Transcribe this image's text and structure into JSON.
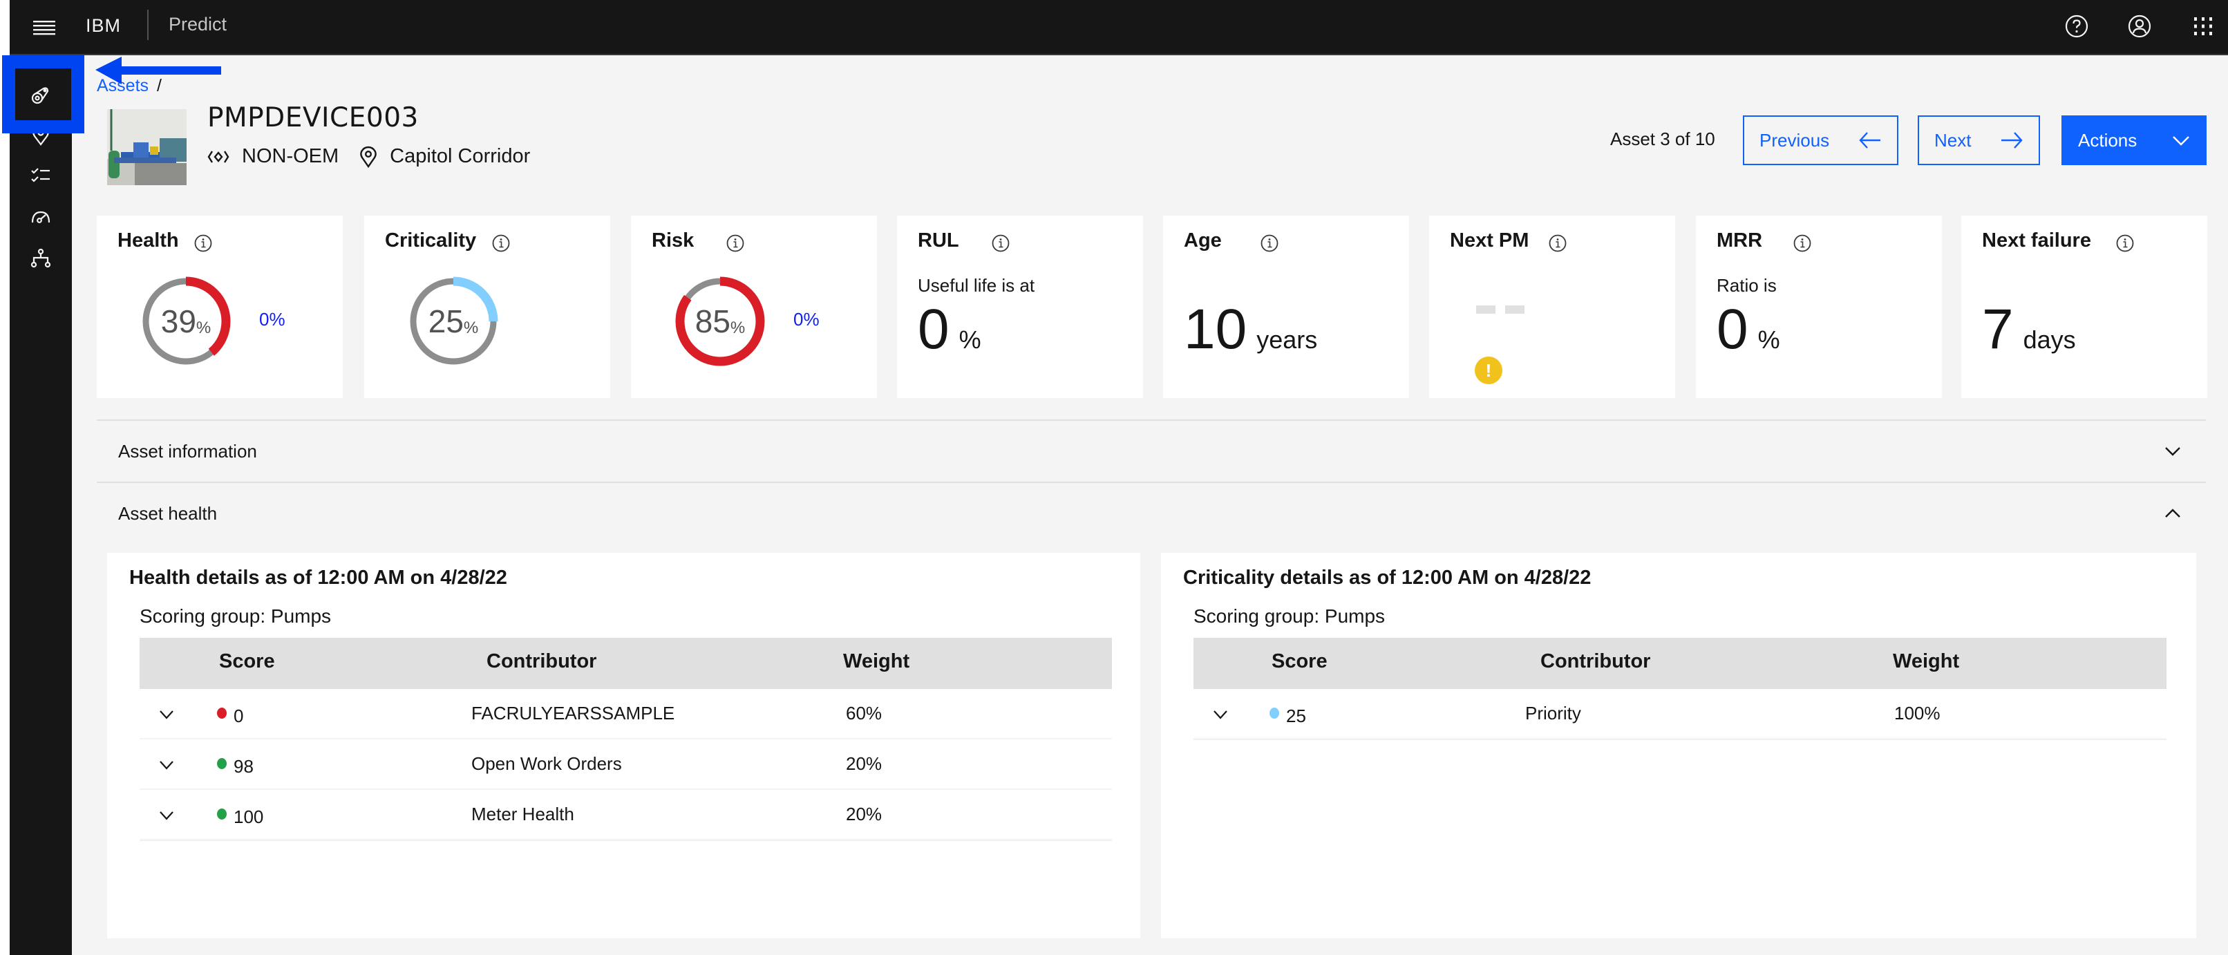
{
  "header": {
    "brand": "IBM",
    "product": "Predict",
    "icons": [
      "help-icon",
      "user-avatar-icon",
      "app-switcher-icon"
    ]
  },
  "sidebar": {
    "items": [
      {
        "icon": "asset-icon",
        "label": "Assets",
        "active": true
      },
      {
        "icon": "location-icon",
        "label": "Locations"
      },
      {
        "icon": "checklist-icon",
        "label": "Work"
      },
      {
        "icon": "dashboard-gauge-icon",
        "label": "Dashboard"
      },
      {
        "icon": "hierarchy-icon",
        "label": "Hierarchy"
      }
    ]
  },
  "breadcrumb": {
    "link": "Assets",
    "separator": "/"
  },
  "asset": {
    "id": "PMPDEVICE003",
    "type": "NON-OEM",
    "location": "Capitol Corridor"
  },
  "pager": {
    "text": "Asset 3 of 10",
    "previous_label": "Previous",
    "next_label": "Next",
    "actions_label": "Actions"
  },
  "kpis": {
    "health": {
      "title": "Health",
      "value": "39",
      "percent": 39,
      "unit": "%",
      "trend": "0%",
      "color": "#da1e28"
    },
    "criticality": {
      "title": "Criticality",
      "value": "25",
      "percent": 25,
      "unit": "%",
      "color": "#82cfff"
    },
    "risk": {
      "title": "Risk",
      "value": "85",
      "percent": 85,
      "unit": "%",
      "trend": "0%",
      "color": "#da1e28"
    },
    "rul": {
      "title": "RUL",
      "sub": "Useful life is at",
      "value": "0",
      "unit": "%"
    },
    "age": {
      "title": "Age",
      "value": "10",
      "unit": "years"
    },
    "next_pm": {
      "title": "Next PM",
      "value": "--",
      "warning": "!"
    },
    "mrr": {
      "title": "MRR",
      "sub": "Ratio is",
      "value": "0",
      "unit": "%"
    },
    "next_failure": {
      "title": "Next failure",
      "value": "7",
      "unit": "days"
    }
  },
  "accordion": {
    "asset_information": "Asset information",
    "asset_health": "Asset health"
  },
  "health_details": {
    "title": "Health details as of 12:00 AM on 4/28/22",
    "scoring_group": "Scoring group:  Pumps",
    "columns": [
      "Score",
      "Contributor",
      "Weight"
    ],
    "rows": [
      {
        "score": "0",
        "status_color": "#da1e28",
        "contributor": "FACRULYEARSSAMPLE",
        "weight": "60%"
      },
      {
        "score": "98",
        "status_color": "#24a148",
        "contributor": "Open Work Orders",
        "weight": "20%"
      },
      {
        "score": "100",
        "status_color": "#24a148",
        "contributor": "Meter Health",
        "weight": "20%"
      }
    ]
  },
  "criticality_details": {
    "title": "Criticality details as of 12:00 AM on 4/28/22",
    "scoring_group": "Scoring group:  Pumps",
    "columns": [
      "Score",
      "Contributor",
      "Weight"
    ],
    "rows": [
      {
        "score": "25",
        "status_color": "#82cfff",
        "contributor": "Priority",
        "weight": "100%"
      }
    ]
  },
  "annotation": {
    "highlight_color": "#0043f0"
  }
}
